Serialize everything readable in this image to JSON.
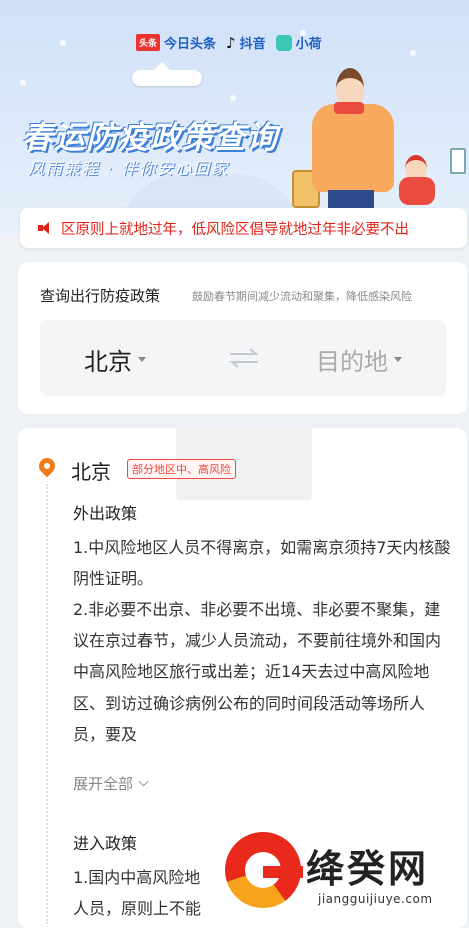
{
  "banner": {
    "brands": [
      "今日头条",
      "抖音",
      "小荷"
    ],
    "toutiao_logo_text": "头条",
    "title": "春运防疫政策查询",
    "subtitle": "风雨兼程 · 伴你安心回家"
  },
  "notice": {
    "icon": "speaker-icon",
    "text": "区原则上就地过年，低风险区倡导就地过年非必要不出"
  },
  "query": {
    "title": "查询出行防疫政策",
    "hint": "鼓励春节期间减少流动和聚集，降低感染风险",
    "origin": "北京",
    "destination": "目的地",
    "swap_icon": "swap-icon"
  },
  "policy": {
    "city": "北京",
    "risk_badge": "部分地区中、高风险",
    "outbound": {
      "title": "外出政策",
      "items": [
        "1.中风险地区人员不得离京，如需离京须持7天内核酸阴性证明。",
        "2.非必要不出京、非必要不出境、非必要不聚集，建议在京过春节，减少人员流动，不要前往境外和国内中高风险地区旅行或出差；近14天去过中高风险地区、到访过确诊病例公布的同时间段活动等场所人员，要及"
      ],
      "expand_label": "展开全部"
    },
    "inbound": {
      "title": "进入政策",
      "items": [
        "1.国内中高风险地",
        "人员，原则上不能"
      ]
    }
  },
  "site_watermark": {
    "name": "绛癸网",
    "url": "jiangguijiuye.com"
  }
}
